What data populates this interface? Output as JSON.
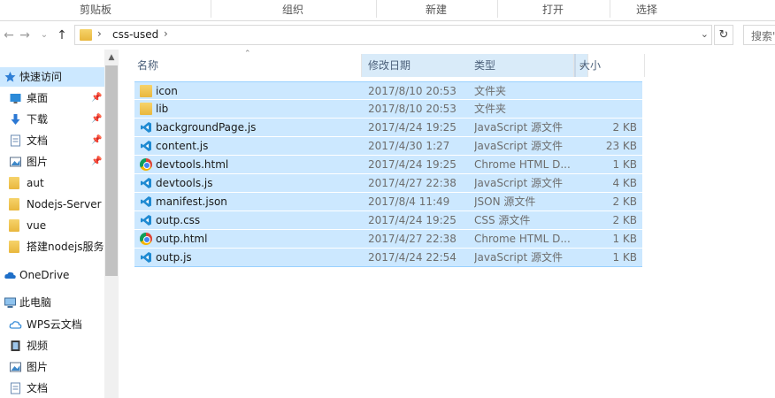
{
  "ribbon": {
    "groups": [
      "剪贴板",
      "组织",
      "新建",
      "打开",
      "选择"
    ]
  },
  "nav": {
    "back_icon": "back-arrow-icon",
    "forward_icon": "forward-arrow-icon",
    "up_icon": "up-arrow-icon",
    "address_separator": "›",
    "path": "css-used",
    "search_placeholder": "搜索\""
  },
  "navpane": {
    "items": [
      {
        "label": "快速访问",
        "icon": "star-icon"
      },
      {
        "label": "桌面",
        "icon": "desktop-icon",
        "pinned": true
      },
      {
        "label": "下载",
        "icon": "download-icon",
        "pinned": true
      },
      {
        "label": "文档",
        "icon": "document-icon",
        "pinned": true
      },
      {
        "label": "图片",
        "icon": "pictures-icon",
        "pinned": true
      },
      {
        "label": "aut",
        "icon": "folder-icon"
      },
      {
        "label": "Nodejs-Server",
        "icon": "folder-icon"
      },
      {
        "label": "vue",
        "icon": "folder-icon"
      },
      {
        "label": "搭建nodejs服务",
        "icon": "folder-icon"
      },
      {
        "label": "OneDrive",
        "icon": "cloud-icon"
      },
      {
        "label": "此电脑",
        "icon": "computer-icon"
      },
      {
        "label": "WPS云文档",
        "icon": "wps-cloud-icon"
      },
      {
        "label": "视频",
        "icon": "video-icon"
      },
      {
        "label": "图片",
        "icon": "pictures-icon"
      },
      {
        "label": "文档",
        "icon": "document-icon"
      }
    ]
  },
  "columns": {
    "name": "名称",
    "date": "修改日期",
    "type": "类型",
    "size": "大小"
  },
  "files": [
    {
      "name": "icon",
      "date": "2017/8/10 20:53",
      "type": "文件夹",
      "size": "",
      "icon": "folder"
    },
    {
      "name": "lib",
      "date": "2017/8/10 20:53",
      "type": "文件夹",
      "size": "",
      "icon": "folder"
    },
    {
      "name": "backgroundPage.js",
      "date": "2017/4/24 19:25",
      "type": "JavaScript 源文件",
      "size": "2 KB",
      "icon": "vscode"
    },
    {
      "name": "content.js",
      "date": "2017/4/30 1:27",
      "type": "JavaScript 源文件",
      "size": "23 KB",
      "icon": "vscode"
    },
    {
      "name": "devtools.html",
      "date": "2017/4/24 19:25",
      "type": "Chrome HTML D...",
      "size": "1 KB",
      "icon": "chrome"
    },
    {
      "name": "devtools.js",
      "date": "2017/4/27 22:38",
      "type": "JavaScript 源文件",
      "size": "4 KB",
      "icon": "vscode"
    },
    {
      "name": "manifest.json",
      "date": "2017/8/4 11:49",
      "type": "JSON 源文件",
      "size": "2 KB",
      "icon": "vscode"
    },
    {
      "name": "outp.css",
      "date": "2017/4/24 19:25",
      "type": "CSS 源文件",
      "size": "2 KB",
      "icon": "vscode"
    },
    {
      "name": "outp.html",
      "date": "2017/4/27 22:38",
      "type": "Chrome HTML D...",
      "size": "1 KB",
      "icon": "chrome"
    },
    {
      "name": "outp.js",
      "date": "2017/4/24 22:54",
      "type": "JavaScript 源文件",
      "size": "1 KB",
      "icon": "vscode"
    }
  ],
  "colors": {
    "selection": "#cce8ff",
    "selection_border": "#99d1ff",
    "header_text": "#4c607a"
  }
}
